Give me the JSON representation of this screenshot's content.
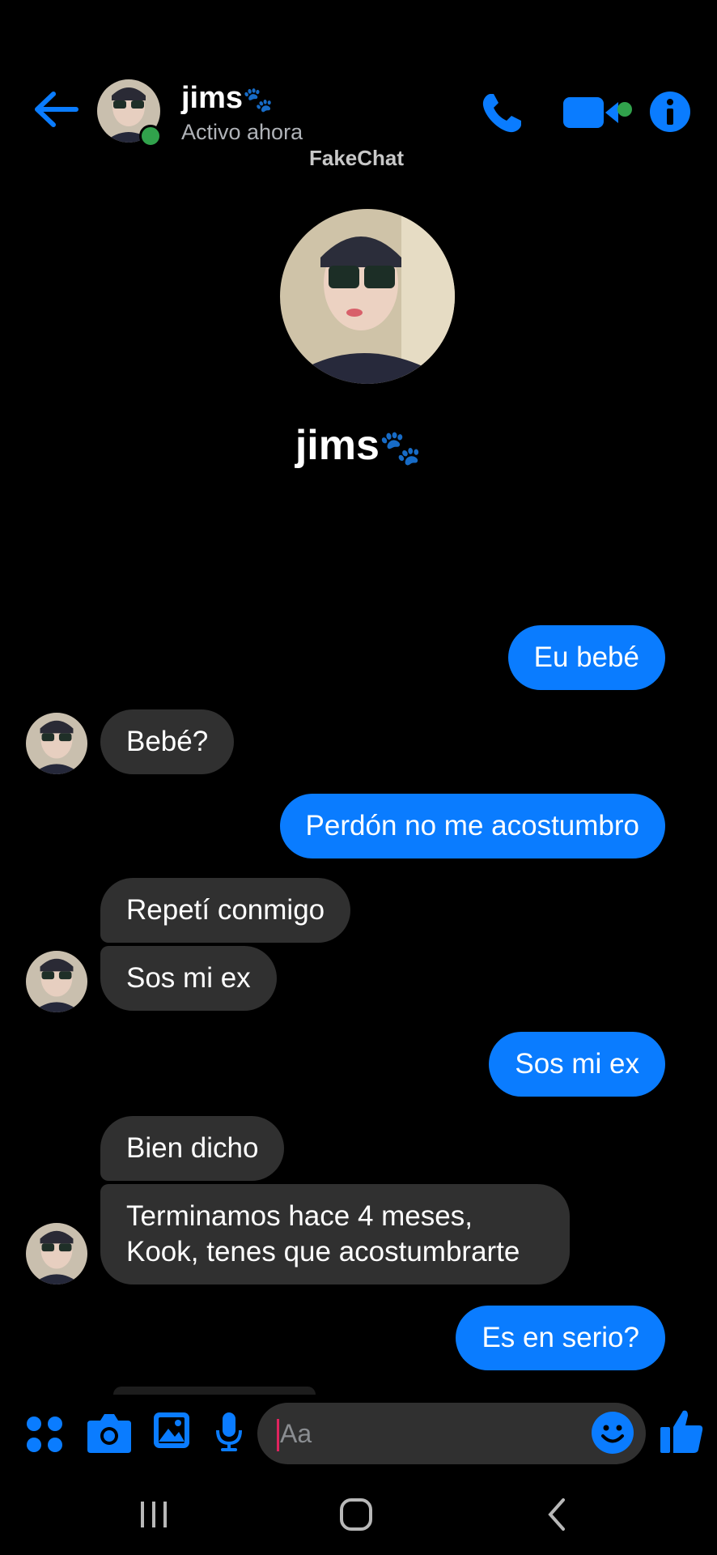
{
  "header": {
    "name": "jims",
    "emoji": "🐾",
    "status": "Activo ahora",
    "watermark": "FakeChat"
  },
  "profile": {
    "name": "jims",
    "emoji": "🐾"
  },
  "messages": [
    {
      "side": "out",
      "text": "Eu bebé"
    },
    {
      "side": "in",
      "text": "Bebé?"
    },
    {
      "side": "out",
      "text": "Perdón no me acostumbro"
    },
    {
      "side": "in",
      "text": "Repetí conmigo"
    },
    {
      "side": "in",
      "text": "Sos mi ex"
    },
    {
      "side": "out",
      "text": "Sos mi ex"
    },
    {
      "side": "in",
      "text": "Bien dicho"
    },
    {
      "side": "in",
      "text": "Terminamos hace 4 meses, Kook, tenes que acostumbrarte"
    },
    {
      "side": "out",
      "text": "Es en serio?"
    }
  ],
  "composer": {
    "placeholder": "Aa"
  },
  "colors": {
    "accent": "#0a7cff",
    "incoming_bubble": "#303030",
    "online": "#31a24c"
  }
}
